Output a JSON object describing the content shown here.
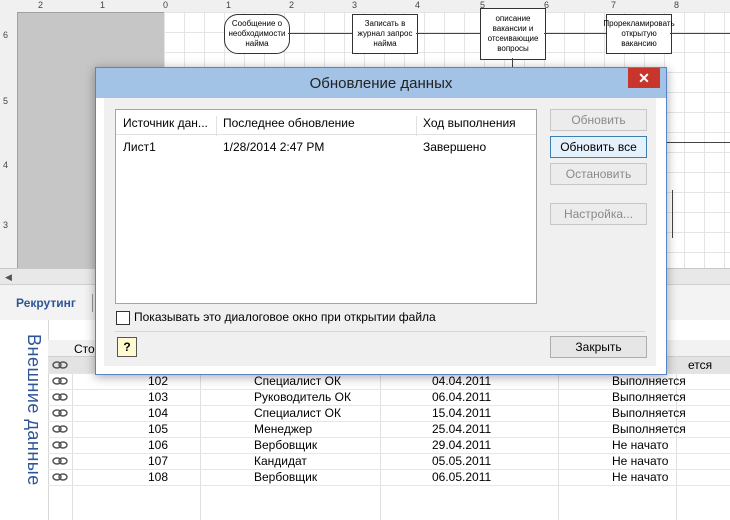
{
  "canvas": {
    "ruler_top_numbers": [
      "2",
      "1",
      "0",
      "1",
      "2",
      "3",
      "4",
      "5",
      "6",
      "7",
      "8"
    ],
    "ruler_left_numbers": [
      "6",
      "5",
      "4",
      "3"
    ],
    "shapes": [
      {
        "text": "Сообщение о необходимости найма"
      },
      {
        "text": "Записать в журнал запрос найма"
      },
      {
        "text": "описание вакансии и отсеивающие вопросы"
      },
      {
        "text": "Прорекламировать открытую вакансию"
      }
    ]
  },
  "tabs": {
    "active": "Рекрутинг"
  },
  "external_data": {
    "title": "Внешние данные",
    "header_first_col": "Сто",
    "rows": [
      {
        "id": "",
        "role": "",
        "date": "",
        "status": "ется"
      },
      {
        "id": "102",
        "role": "Специалист ОК",
        "date": "04.04.2011",
        "status": "Выполняется"
      },
      {
        "id": "103",
        "role": "Руководитель ОК",
        "date": "06.04.2011",
        "status": "Выполняется"
      },
      {
        "id": "104",
        "role": "Специалист ОК",
        "date": "15.04.2011",
        "status": "Выполняется"
      },
      {
        "id": "105",
        "role": "Менеджер",
        "date": "25.04.2011",
        "status": "Выполняется"
      },
      {
        "id": "106",
        "role": "Вербовщик",
        "date": "29.04.2011",
        "status": "Не начато"
      },
      {
        "id": "107",
        "role": "Кандидат",
        "date": "05.05.2011",
        "status": "Не начато"
      },
      {
        "id": "108",
        "role": "Вербовщик",
        "date": "06.05.2011",
        "status": "Не начато"
      }
    ]
  },
  "dialog": {
    "title": "Обновление данных",
    "close_glyph": "✕",
    "columns": [
      "Источник дан...",
      "Последнее обновление",
      "Ход выполнения"
    ],
    "rows": [
      {
        "source": "Лист1",
        "last_update": "1/28/2014 2:47 PM",
        "progress": "Завершено"
      }
    ],
    "buttons": {
      "refresh": "Обновить",
      "refresh_all": "Обновить все",
      "stop": "Остановить",
      "settings": "Настройка..."
    },
    "checkbox_label": "Показывать это диалоговое окно при открытии файла",
    "checkbox_checked": false,
    "help_glyph": "?",
    "close_button": "Закрыть"
  }
}
